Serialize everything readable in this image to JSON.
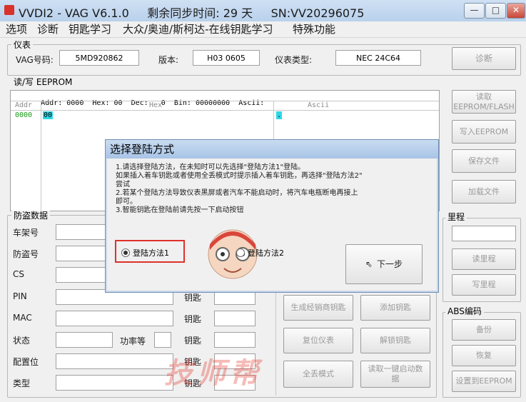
{
  "titlebar": {
    "title": "VVDI2 - VAG V6.1.0     剩余同步时间: 29 天     SN:VV20296075",
    "minimize": "—",
    "maximize": "□",
    "close": "✕"
  },
  "menu": [
    "选项",
    "诊断",
    "钥匙学习",
    "大众/奥迪/斯柯达-在线钥匙学习",
    "特殊功能"
  ],
  "instrument": {
    "group_label": "仪表",
    "vag_label": "VAG号码:",
    "vag_value": "5MD920862",
    "version_label": "版本:",
    "version_value": "H03 0605",
    "type_label": "仪表类型:",
    "type_value": "NEC 24C64",
    "diagnose_button": "诊断"
  },
  "eeprom": {
    "group_label": "读/写 EEPROM",
    "status_addr_label": "Addr:",
    "status_addr": "0000",
    "status_hex_label": "Hex:",
    "status_hex": "00",
    "status_dec_label": "Dec:",
    "status_dec": "0",
    "status_bin_label": "Bin:",
    "status_bin": "00000000",
    "status_ascii_label": "Ascii:",
    "col_addr": "Addr",
    "col_hex": "Hex",
    "col_ascii": "Ascii",
    "row_addr": "0000",
    "row_hex": "00",
    "row_ascii": "."
  },
  "right_buttons": {
    "read": "读取 EEPROM/FLASH",
    "write": "写入EEPROM",
    "save": "保存文件",
    "load": "加载文件"
  },
  "mileage": {
    "group_label": "里程",
    "read_button": "读里程",
    "write_button": "写里程"
  },
  "abs": {
    "group_label": "ABS编码",
    "backup_button": "备份",
    "restore_button": "恢复",
    "set_button": "设置到EEPROM"
  },
  "immo": {
    "group_label": "防盗数据",
    "labels": [
      "车架号",
      "防盗号",
      "CS",
      "PIN",
      "MAC",
      "状态",
      "配置位",
      "类型"
    ],
    "key_label": "钥匙",
    "power_label": "功率等",
    "gen_dealer_key": "生成经销商钥匙",
    "add_key": "添加钥匙",
    "reset_instrument": "复位仪表",
    "unlock_key": "解锁钥匙",
    "all_lost_mode": "全丢模式",
    "read_one_key": "读取一键启动数据"
  },
  "dialog": {
    "title": "选择登陆方式",
    "lines": [
      "1.请选择登陆方法，在未知时可以先选择\"登陆方法1\"登陆。",
      "如果插入着车钥匙或者使用全丢模式时提示插入着车钥匙，再选择\"登陆方法2\"",
      "尝试",
      "2.若某个登陆方法导致仪表黑屏或者汽车不能启动时，将汽车电瓶断电再接上",
      "即可。",
      "3.智能钥匙在登陆前请先按一下启动按钮"
    ],
    "option1": "登陆方法1",
    "option2": "登陆方法2",
    "next_button": "下一步"
  },
  "watermark": "技师帮"
}
